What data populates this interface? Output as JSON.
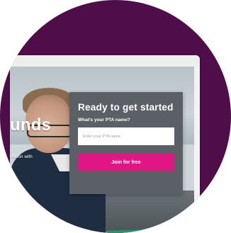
{
  "hero": {
    "title_partial": "unds",
    "subtext_partial": "million with"
  },
  "signup": {
    "title": "Ready to get started",
    "label": "What's your PTA name?",
    "input_placeholder": "Enter your PTA name",
    "input_value": "",
    "button_label": "Join for free"
  },
  "colors": {
    "circle_purple": "#4f0e49",
    "card_gray": "#5a6066",
    "cta_pink": "#e01684"
  }
}
